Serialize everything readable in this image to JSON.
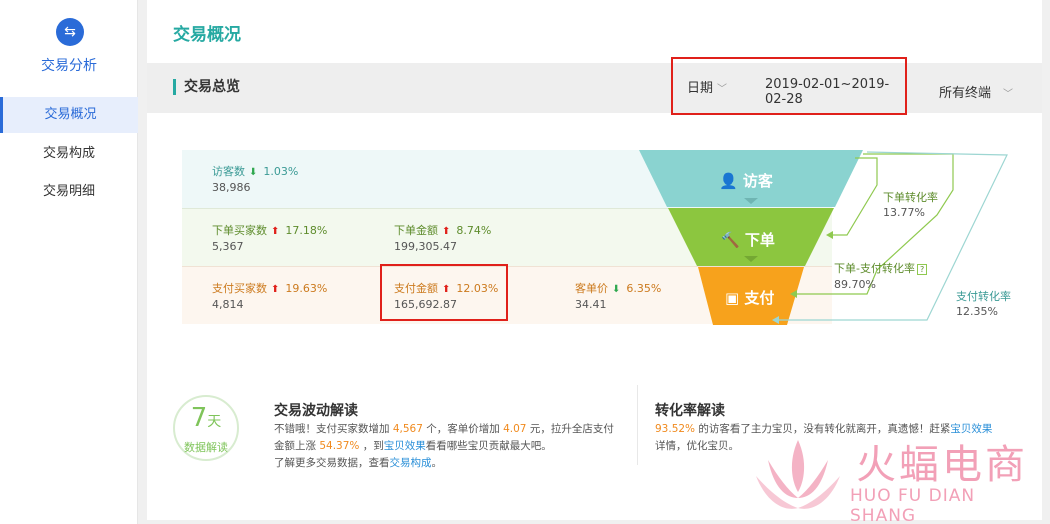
{
  "sidebar": {
    "title": "交易分析",
    "items": [
      {
        "label": "交易概况",
        "active": true
      },
      {
        "label": "交易构成",
        "active": false
      },
      {
        "label": "交易明细",
        "active": false
      }
    ]
  },
  "header": {
    "title": "交易概况"
  },
  "section": {
    "title": "交易总览",
    "date_label": "日期",
    "date_range": "2019-02-01~2019-02-28",
    "terminal": "所有终端"
  },
  "metrics": {
    "visitors": {
      "label": "访客数",
      "value": "38,986",
      "change": "1.03%",
      "trend": "down"
    },
    "order_buyers": {
      "label": "下单买家数",
      "value": "5,367",
      "change": "17.18%",
      "trend": "up"
    },
    "order_amount": {
      "label": "下单金额",
      "value": "199,305.47",
      "change": "8.74%",
      "trend": "up"
    },
    "pay_buyers": {
      "label": "支付买家数",
      "value": "4,814",
      "change": "19.63%",
      "trend": "up"
    },
    "pay_amount": {
      "label": "支付金额",
      "value": "165,692.87",
      "change": "12.03%",
      "trend": "up"
    },
    "unit_price": {
      "label": "客单价",
      "value": "34.41",
      "change": "6.35%",
      "trend": "down"
    }
  },
  "funnel": {
    "stage1": "访客",
    "stage2": "下单",
    "stage3": "支付",
    "colors": {
      "visit": "#8ad3d0",
      "order": "#8cc63f",
      "pay": "#f7a21c"
    }
  },
  "rates": {
    "order_rate": {
      "label": "下单转化率",
      "value": "13.77%"
    },
    "order_pay_rate": {
      "label": "下单-支付转化率",
      "help": "?",
      "value": "89.70%"
    },
    "pay_rate": {
      "label": "支付转化率",
      "value": "12.35%"
    }
  },
  "badge": {
    "num": "7",
    "unit": "天",
    "text": "数据解读"
  },
  "wave": {
    "title": "交易波动解读",
    "l1a": "不错哦！支付买家数增加 ",
    "l1b": "4,567",
    "l1c": " 个，客单价增加 ",
    "l1d": "4.07",
    "l1e": " 元，拉升全店支付",
    "l2a": "金额上涨 ",
    "l2b": "54.37%",
    "l2c": " ，到",
    "l2d": "宝贝效果",
    "l2e": "看看哪些宝贝贡献最大吧。",
    "l3a": "了解更多交易数据，查看",
    "l3b": "交易构成",
    "l3c": "。"
  },
  "conv": {
    "title": "转化率解读",
    "l1a": "93.52%",
    "l1b": " 的访客看了主力宝贝，没有转化就离开，真遗憾！赶紧",
    "l1c": "宝贝效果",
    "l2": "详情，优化宝贝。"
  },
  "watermark": {
    "cn": "火蝠电商",
    "en": "HUO FU DIAN SHANG"
  }
}
